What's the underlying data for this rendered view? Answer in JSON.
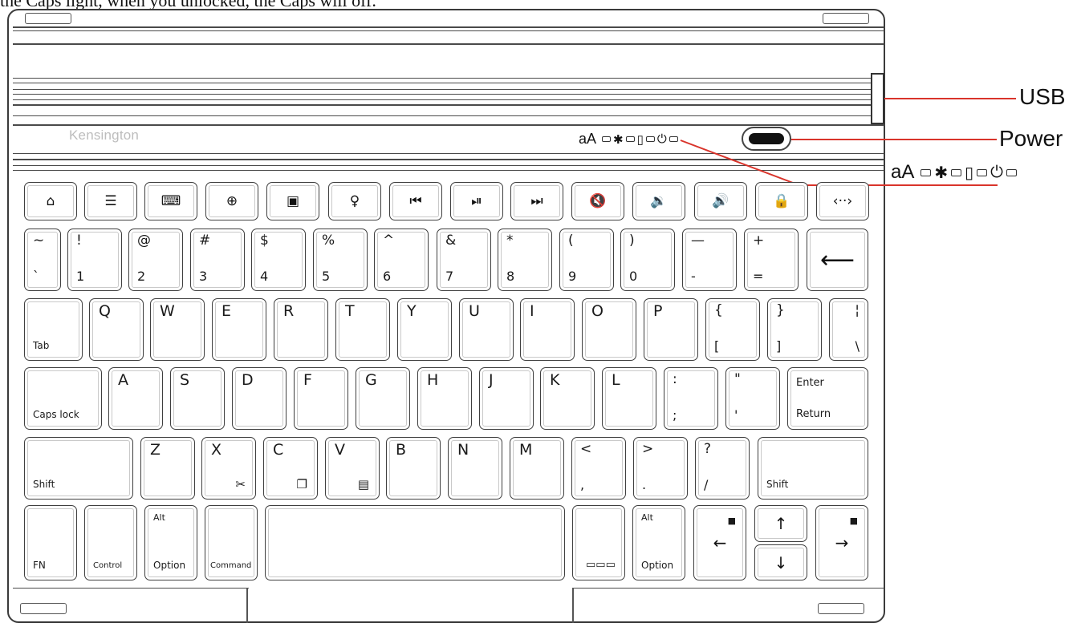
{
  "caption": "the Caps light, when you unlocked, the Caps will off.",
  "brand": "Kensington",
  "indicators": {
    "caps": "aA",
    "bluetooth": "bluetooth-icon",
    "battery": "battery-icon",
    "power": "power-icon"
  },
  "callouts": {
    "usb": "USB",
    "power": "Power",
    "indicator_caps": "aA"
  },
  "line_color": "#d9342b",
  "function_row": [
    {
      "name": "home-key",
      "icon": "home-icon",
      "glyph": "⌂"
    },
    {
      "name": "search-key",
      "icon": "search-icon",
      "glyph": "🔍"
    },
    {
      "name": "keyboard-key",
      "icon": "keyboard-icon",
      "glyph": "⌨"
    },
    {
      "name": "globe-key",
      "icon": "globe-icon",
      "glyph": "🌐"
    },
    {
      "name": "contacts-key",
      "icon": "contacts-icon",
      "glyph": "▣"
    },
    {
      "name": "mic-key",
      "icon": "microphone-icon",
      "glyph": "🎙"
    },
    {
      "name": "prev-track-key",
      "icon": "previous-track-icon",
      "glyph": "⏮"
    },
    {
      "name": "play-pause-key",
      "icon": "play-pause-icon",
      "glyph": "⏯"
    },
    {
      "name": "next-track-key",
      "icon": "next-track-icon",
      "glyph": "⏭"
    },
    {
      "name": "mute-key",
      "icon": "mute-icon",
      "glyph": "🔇"
    },
    {
      "name": "volume-down-key",
      "icon": "volume-down-icon",
      "glyph": "🔉"
    },
    {
      "name": "volume-up-key",
      "icon": "volume-up-icon",
      "glyph": "🔊"
    },
    {
      "name": "lock-key",
      "icon": "lock-icon",
      "glyph": "🔒"
    },
    {
      "name": "switch-key",
      "icon": "switch-icon",
      "glyph": "‹··›"
    }
  ],
  "number_row": [
    {
      "top": "~",
      "bottom": "`"
    },
    {
      "top": "!",
      "bottom": "1"
    },
    {
      "top": "@",
      "bottom": "2"
    },
    {
      "top": "#",
      "bottom": "3"
    },
    {
      "top": "$",
      "bottom": "4"
    },
    {
      "top": "%",
      "bottom": "5"
    },
    {
      "top": "^",
      "bottom": "6"
    },
    {
      "top": "&",
      "bottom": "7"
    },
    {
      "top": "*",
      "bottom": "8"
    },
    {
      "top": "(",
      "bottom": "9"
    },
    {
      "top": ")",
      "bottom": "0"
    },
    {
      "top": "—",
      "bottom": "-"
    },
    {
      "top": "+",
      "bottom": "="
    }
  ],
  "backspace_glyph": "⟵",
  "tab_label": "Tab",
  "q_row": [
    "Q",
    "W",
    "E",
    "R",
    "T",
    "Y",
    "U",
    "I",
    "O",
    "P"
  ],
  "q_row_symbols": [
    {
      "top": "{",
      "bottom": "["
    },
    {
      "top": "}",
      "bottom": "]"
    },
    {
      "top": "¦",
      "bottom": "\\"
    }
  ],
  "capslock_label": "Caps lock",
  "a_row": [
    "A",
    "S",
    "D",
    "F",
    "G",
    "H",
    "J",
    "K",
    "L"
  ],
  "a_row_symbols": [
    {
      "top": ":",
      "bottom": ";"
    },
    {
      "top": "\"",
      "bottom": "'"
    }
  ],
  "enter_label": "Enter",
  "return_label": "Return",
  "shift_label": "Shift",
  "z_row": [
    "Z",
    "X",
    "C",
    "V",
    "B",
    "N",
    "M"
  ],
  "z_row_symbols": [
    {
      "top": "<",
      "bottom": ","
    },
    {
      "top": ">",
      "bottom": "."
    },
    {
      "top": "?",
      "bottom": "/"
    }
  ],
  "bottom_row": {
    "fn": "FN",
    "control": "Control",
    "alt": "Alt",
    "option": "Option",
    "command": "Command"
  }
}
